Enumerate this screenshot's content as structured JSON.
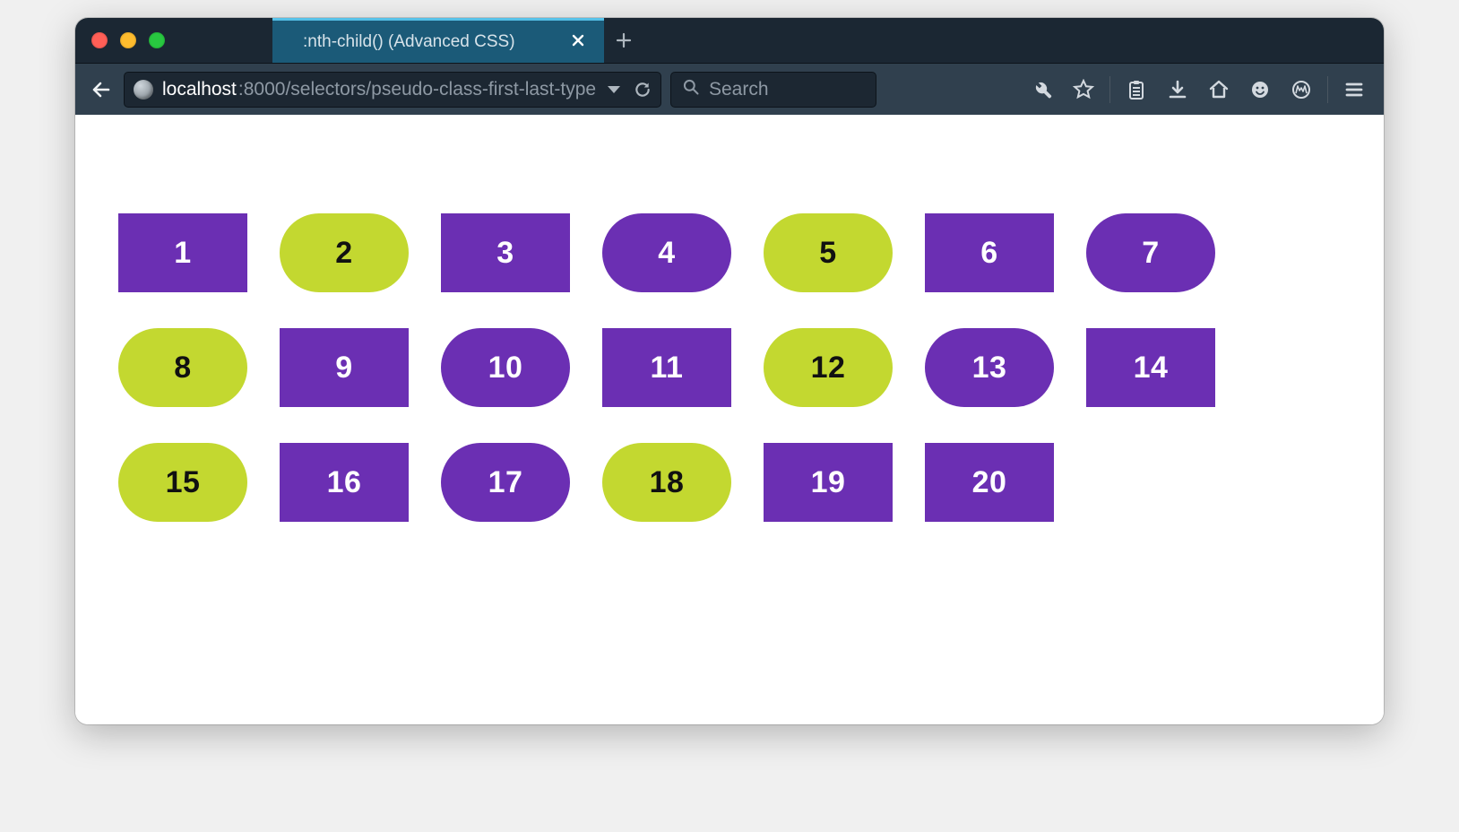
{
  "window": {
    "tab_title": ":nth-child() (Advanced CSS)"
  },
  "toolbar": {
    "url_host": "localhost",
    "url_path": ":8000/selectors/pseudo-class-first-last-type",
    "search_placeholder": "Search"
  },
  "colors": {
    "purple": "#6b2fb3",
    "lime": "#c3d830"
  },
  "boxes": [
    {
      "label": "1",
      "shape": "rect",
      "color": "purple"
    },
    {
      "label": "2",
      "shape": "pill",
      "color": "lime"
    },
    {
      "label": "3",
      "shape": "rect",
      "color": "purple"
    },
    {
      "label": "4",
      "shape": "pill",
      "color": "purple"
    },
    {
      "label": "5",
      "shape": "pill",
      "color": "lime"
    },
    {
      "label": "6",
      "shape": "rect",
      "color": "purple"
    },
    {
      "label": "7",
      "shape": "pill",
      "color": "purple"
    },
    {
      "label": "8",
      "shape": "pill",
      "color": "lime"
    },
    {
      "label": "9",
      "shape": "rect",
      "color": "purple"
    },
    {
      "label": "10",
      "shape": "pill",
      "color": "purple"
    },
    {
      "label": "11",
      "shape": "rect",
      "color": "purple"
    },
    {
      "label": "12",
      "shape": "pill",
      "color": "lime"
    },
    {
      "label": "13",
      "shape": "pill",
      "color": "purple"
    },
    {
      "label": "14",
      "shape": "rect",
      "color": "purple"
    },
    {
      "label": "15",
      "shape": "pill",
      "color": "lime"
    },
    {
      "label": "16",
      "shape": "rect",
      "color": "purple"
    },
    {
      "label": "17",
      "shape": "pill",
      "color": "purple"
    },
    {
      "label": "18",
      "shape": "pill",
      "color": "lime"
    },
    {
      "label": "19",
      "shape": "rect",
      "color": "purple"
    },
    {
      "label": "20",
      "shape": "rect",
      "color": "purple"
    }
  ]
}
